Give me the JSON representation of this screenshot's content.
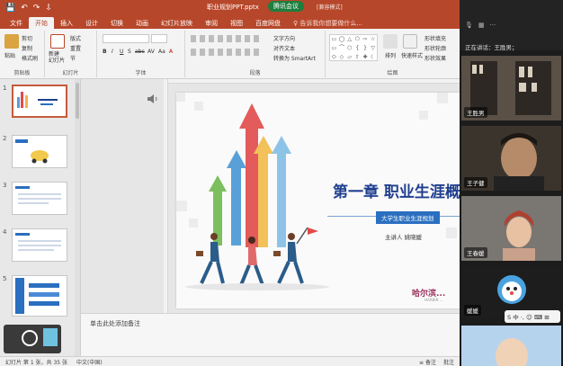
{
  "titlebar": {
    "qat": [
      "💾",
      "↶",
      "↷",
      "⇩"
    ],
    "doc_title": "职业规划PPT.pptx",
    "meeting_pill": "腾讯会议",
    "compat": "[兼容模式]"
  },
  "tabs": [
    "文件",
    "开始",
    "插入",
    "设计",
    "切换",
    "动画",
    "幻灯片放映",
    "审阅",
    "视图",
    "百度网盘"
  ],
  "tell_me": "♀ 告诉我你想要做什么...",
  "ribbon": {
    "paste": "粘贴",
    "cut": "剪切",
    "copy": "复制",
    "format_painter": "格式刷",
    "clipboard_label": "剪贴板",
    "new_slide": "新建\n幻灯片",
    "layout": "版式",
    "reset": "重置",
    "section": "节",
    "slides_label": "幻灯片",
    "font_label": "字体",
    "paragraph_label": "段落",
    "text_direction": "文字方向",
    "align_text": "对齐文本",
    "smartart": "转换为 SmartArt",
    "arrange": "排列",
    "quick_styles": "快速样式",
    "shape_fill": "形状填充",
    "shape_outline": "形状轮廓",
    "shape_effects": "形状效果",
    "drawing_label": "绘图",
    "font_bold": "B",
    "font_italic": "I",
    "font_underline": "U",
    "font_strike": "S",
    "font_abc": "abc",
    "font_av": "AV",
    "font_aa": "Aa",
    "font_a": "A"
  },
  "thumb_numbers": [
    "1",
    "2",
    "3",
    "4",
    "5"
  ],
  "slide": {
    "title": "第一章  职业生涯概",
    "subtitle": "大学生职业生涯规划",
    "presenter": "主讲人  姚晓媛",
    "logo": "哈尔滨...",
    "logo_sub": "HARBIN ..."
  },
  "notes": "单击此处添加备注",
  "status": {
    "slide_count": "幻灯片 第 1 张，共 35 张",
    "language": "中文(中国)",
    "notes_btn": "≡ 备注",
    "comments": "批注"
  },
  "meeting": {
    "speaking": "正在讲话：王胜男；",
    "participants": [
      "王胜男",
      "王子健",
      "王春媛",
      "媛媛"
    ],
    "ime": "S 中 ·, ☺ ⌨ ⊞"
  },
  "colors": {
    "accent": "#b7472a",
    "title_blue": "#1f3f8f"
  }
}
